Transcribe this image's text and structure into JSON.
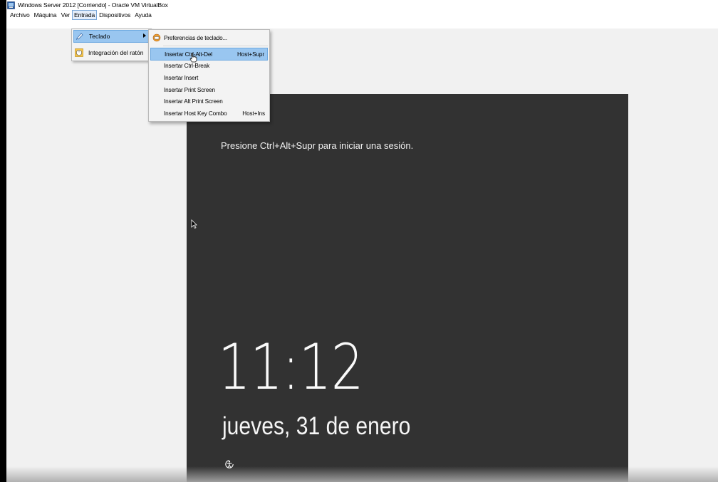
{
  "window": {
    "title": "Windows Server 2012 [Corriendo] - Oracle VM VirtualBox",
    "icon": "virtualbox-icon"
  },
  "menubar": {
    "items": [
      {
        "label": "Archivo"
      },
      {
        "label": "Máquina"
      },
      {
        "label": "Ver"
      },
      {
        "label": "Entrada",
        "active": true
      },
      {
        "label": "Dispositivos"
      },
      {
        "label": "Ayuda"
      }
    ]
  },
  "entrada_menu": {
    "items": [
      {
        "label": "Teclado",
        "icon": "keyboard-icon",
        "has_submenu": true,
        "selected": true
      },
      {
        "label": "Integración del ratón",
        "icon": "mouse-integration-icon"
      }
    ]
  },
  "teclado_submenu": {
    "items": [
      {
        "label": "Preferencias de teclado...",
        "icon": "keyboard-preferences-icon",
        "shortcut": ""
      },
      {
        "label": "Insertar Ctrl-Alt-Del",
        "shortcut": "Host+Supr",
        "selected": true
      },
      {
        "label": "Insertar Ctrl-Break",
        "shortcut": ""
      },
      {
        "label": "Insertar Insert",
        "shortcut": ""
      },
      {
        "label": "Insertar Print Screen",
        "shortcut": ""
      },
      {
        "label": "Insertar Alt Print Screen",
        "shortcut": ""
      },
      {
        "label": "Insertar Host Key Combo",
        "shortcut": "Host+Ins"
      }
    ]
  },
  "lockscreen": {
    "message": "Presione Ctrl+Alt+Supr para iniciar una sesión.",
    "time": "11:12",
    "date": "jueves, 31 de enero",
    "accessibility_icon": "ease-of-access-icon"
  },
  "colors": {
    "lockscreen_bg": "#323232",
    "menu_highlight": "#99c6f0",
    "menu_bg": "#f3f3f3"
  }
}
